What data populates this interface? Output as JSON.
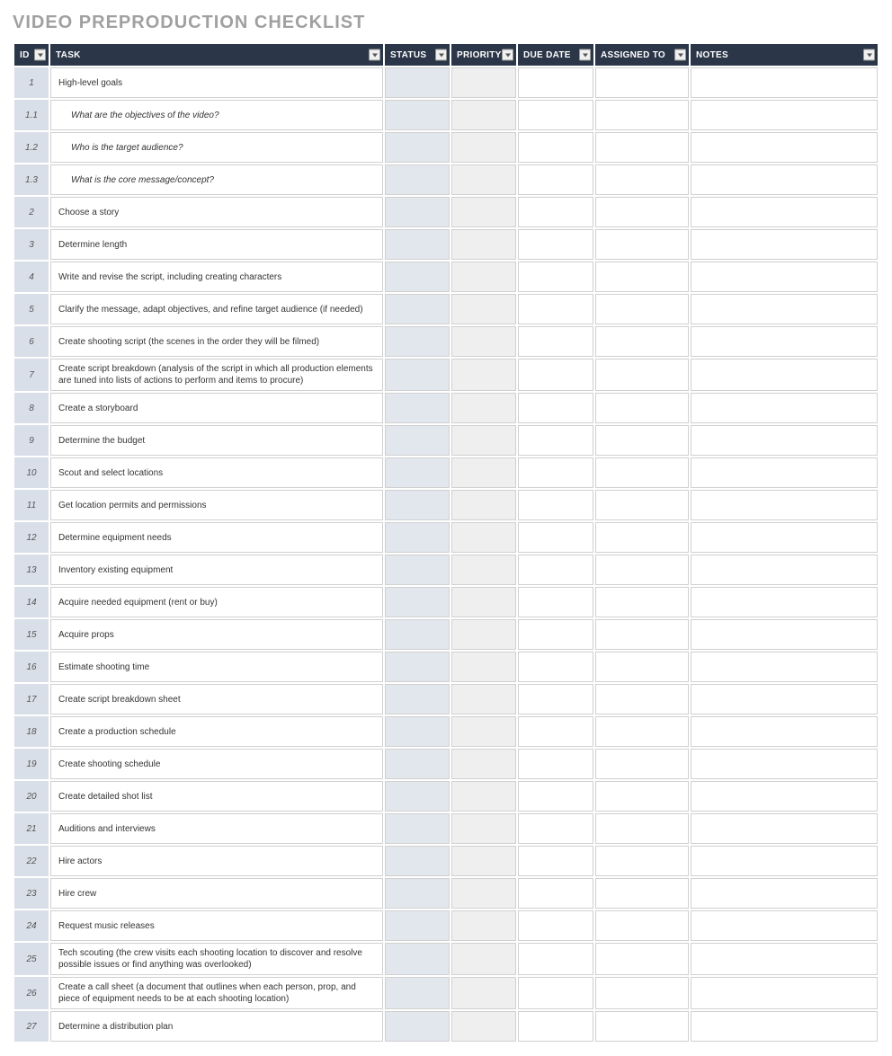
{
  "title": "VIDEO PREPRODUCTION CHECKLIST",
  "columns": {
    "id": "ID",
    "task": "TASK",
    "status": "STATUS",
    "priority": "PRIORITY",
    "due": "DUE DATE",
    "assigned": "ASSIGNED TO",
    "notes": "NOTES"
  },
  "rows": [
    {
      "id": "1",
      "task": "High-level goals",
      "sub": false
    },
    {
      "id": "1.1",
      "task": "What are the objectives of the video?",
      "sub": true
    },
    {
      "id": "1.2",
      "task": "Who is the target audience?",
      "sub": true
    },
    {
      "id": "1.3",
      "task": "What is the core message/concept?",
      "sub": true
    },
    {
      "id": "2",
      "task": "Choose a story",
      "sub": false
    },
    {
      "id": "3",
      "task": "Determine length",
      "sub": false
    },
    {
      "id": "4",
      "task": "Write and revise the script, including creating characters",
      "sub": false
    },
    {
      "id": "5",
      "task": "Clarify the message, adapt objectives, and refine target audience (if needed)",
      "sub": false
    },
    {
      "id": "6",
      "task": "Create shooting script (the scenes in the order they will be filmed)",
      "sub": false
    },
    {
      "id": "7",
      "task": "Create script breakdown (analysis of the script in which all production elements are tuned into lists of actions to perform and items to procure)",
      "sub": false
    },
    {
      "id": "8",
      "task": "Create a storyboard",
      "sub": false
    },
    {
      "id": "9",
      "task": "Determine the budget",
      "sub": false
    },
    {
      "id": "10",
      "task": "Scout and select locations",
      "sub": false
    },
    {
      "id": "11",
      "task": "Get location permits and permissions",
      "sub": false
    },
    {
      "id": "12",
      "task": "Determine equipment needs",
      "sub": false
    },
    {
      "id": "13",
      "task": "Inventory existing equipment",
      "sub": false
    },
    {
      "id": "14",
      "task": "Acquire needed equipment (rent or buy)",
      "sub": false
    },
    {
      "id": "15",
      "task": "Acquire props",
      "sub": false
    },
    {
      "id": "16",
      "task": "Estimate shooting time",
      "sub": false
    },
    {
      "id": "17",
      "task": "Create script breakdown sheet",
      "sub": false
    },
    {
      "id": "18",
      "task": "Create a production schedule",
      "sub": false
    },
    {
      "id": "19",
      "task": "Create shooting schedule",
      "sub": false
    },
    {
      "id": "20",
      "task": "Create detailed shot list",
      "sub": false
    },
    {
      "id": "21",
      "task": "Auditions and interviews",
      "sub": false
    },
    {
      "id": "22",
      "task": "Hire actors",
      "sub": false
    },
    {
      "id": "23",
      "task": "Hire crew",
      "sub": false
    },
    {
      "id": "24",
      "task": "Request music releases",
      "sub": false
    },
    {
      "id": "25",
      "task": "Tech scouting (the crew visits each shooting location to discover and resolve possible issues or find anything was overlooked)",
      "sub": false
    },
    {
      "id": "26",
      "task": "Create a call sheet (a document that outlines when each person, prop, and piece of equipment needs to be at each shooting location)",
      "sub": false
    },
    {
      "id": "27",
      "task": "Determine a distribution plan",
      "sub": false
    }
  ]
}
